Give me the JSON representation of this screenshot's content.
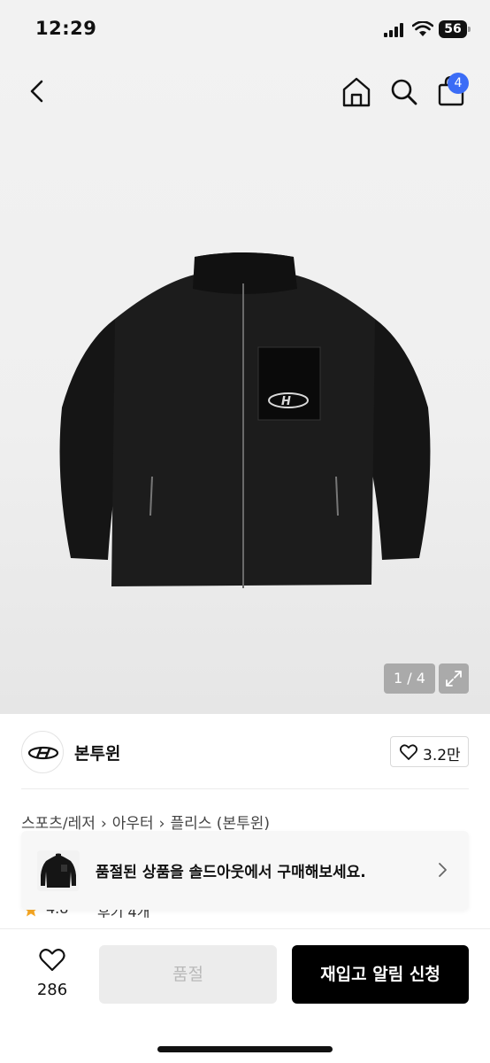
{
  "status_bar": {
    "time": "12:29",
    "battery": "56"
  },
  "nav": {
    "back_icon": "chevron-left-icon",
    "home_icon": "home-icon",
    "search_icon": "search-icon",
    "cart_icon": "shopping-bag-icon",
    "cart_badge": "4",
    "badge_color": "#3b6cf6"
  },
  "gallery": {
    "counter": "1 / 4",
    "expand_icon": "expand-icon"
  },
  "brand": {
    "name": "본투윈",
    "like_count": "3.2만"
  },
  "breadcrumb": {
    "items": [
      "스포츠/레저",
      "아우터",
      "플리스 (본투윈)"
    ]
  },
  "rating": {
    "score": "4.8",
    "link": "후기 4개"
  },
  "soldout_banner": {
    "text": "품절된 상품을 솔드아웃에서 구매해보세요."
  },
  "bottom_bar": {
    "wish_count": "286",
    "soldout_label": "품절",
    "restock_label": "재입고 알림 신청"
  }
}
